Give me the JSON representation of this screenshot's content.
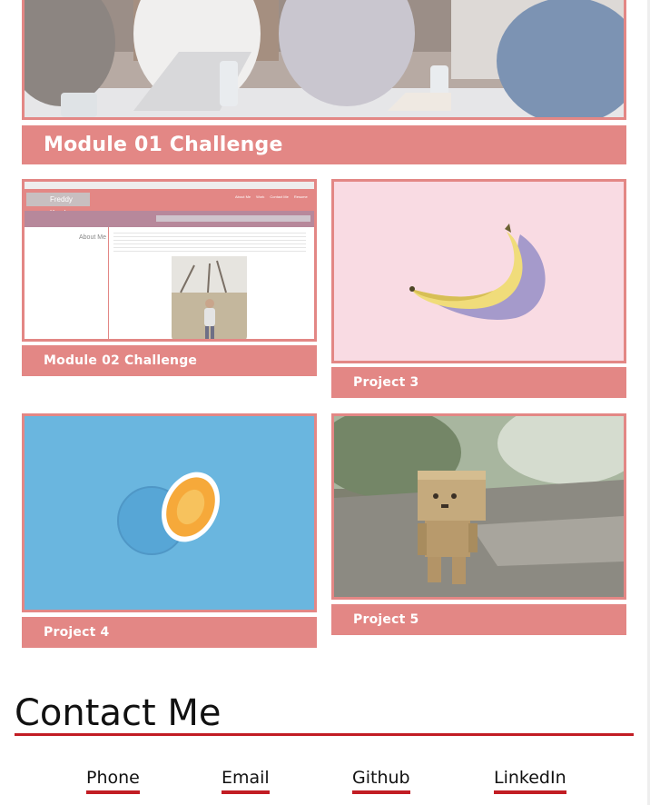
{
  "cards": [
    {
      "title": "Module 01 Challenge",
      "image": "team-meeting-laptops-photo"
    },
    {
      "title": "Module 02 Challenge",
      "image": "portfolio-site-screenshot",
      "preview": {
        "site_name": "Freddy Kwak",
        "nav": [
          "About Me",
          "Work",
          "Contact Me",
          "Resume"
        ],
        "section": "About Me"
      }
    },
    {
      "title": "Project 3",
      "image": "banana-on-pink-photo"
    },
    {
      "title": "Project 4",
      "image": "orange-on-blue-photo"
    },
    {
      "title": "Project 5",
      "image": "cardboard-robot-photo"
    }
  ],
  "contact": {
    "heading": "Contact Me",
    "links": [
      "Phone",
      "Email",
      "Github",
      "LinkedIn"
    ]
  },
  "colors": {
    "card_accent": "#e38785",
    "rule_red": "#c21d24",
    "banana_bg": "#f9dbe3",
    "orange_bg": "#6ab6df"
  }
}
